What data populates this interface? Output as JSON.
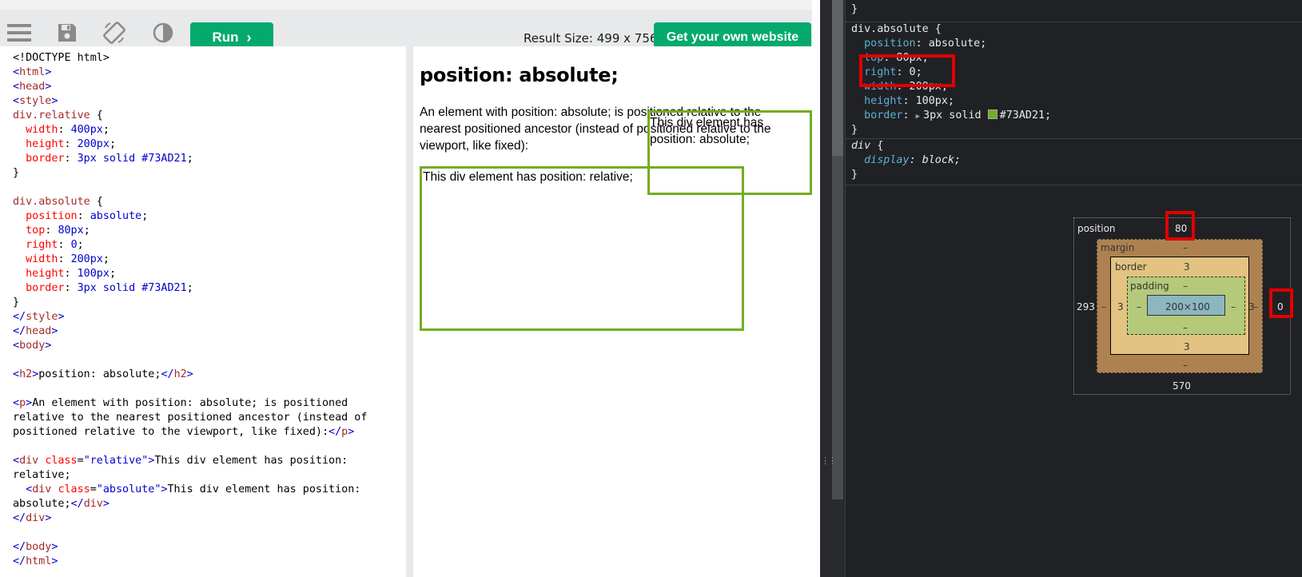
{
  "toolbar": {
    "icons": [
      "menu-icon",
      "save-icon",
      "rotate-icon",
      "contrast-icon"
    ],
    "run_label": "Run",
    "result_size": "Result Size: 499 x 756",
    "own_site_label": "Get your own website",
    "accent": "#04aa6d"
  },
  "editor": {
    "lines": [
      [
        [
          "p",
          "<!DOCTYPE html>"
        ]
      ],
      [
        [
          "a",
          "<"
        ],
        [
          "t",
          "html"
        ],
        [
          "a",
          ">"
        ]
      ],
      [
        [
          "a",
          "<"
        ],
        [
          "t",
          "head"
        ],
        [
          "a",
          ">"
        ]
      ],
      [
        [
          "a",
          "<"
        ],
        [
          "t",
          "style"
        ],
        [
          "a",
          ">"
        ]
      ],
      [
        [
          "s",
          "div.relative"
        ],
        [
          "p",
          " {"
        ]
      ],
      [
        [
          "p",
          "  "
        ],
        [
          "k",
          "width"
        ],
        [
          "p",
          ": "
        ],
        [
          "v",
          "400px"
        ],
        [
          "p",
          ";"
        ]
      ],
      [
        [
          "p",
          "  "
        ],
        [
          "k",
          "height"
        ],
        [
          "p",
          ": "
        ],
        [
          "v",
          "200px"
        ],
        [
          "p",
          ";"
        ]
      ],
      [
        [
          "p",
          "  "
        ],
        [
          "k",
          "border"
        ],
        [
          "p",
          ": "
        ],
        [
          "v",
          "3px solid #73AD21"
        ],
        [
          "p",
          ";"
        ]
      ],
      [
        [
          "p",
          "}"
        ]
      ],
      [
        [
          "p",
          ""
        ]
      ],
      [
        [
          "s",
          "div.absolute"
        ],
        [
          "p",
          " {"
        ]
      ],
      [
        [
          "p",
          "  "
        ],
        [
          "k",
          "position"
        ],
        [
          "p",
          ": "
        ],
        [
          "v",
          "absolute"
        ],
        [
          "p",
          ";"
        ]
      ],
      [
        [
          "p",
          "  "
        ],
        [
          "k",
          "top"
        ],
        [
          "p",
          ": "
        ],
        [
          "v",
          "80px"
        ],
        [
          "p",
          ";"
        ]
      ],
      [
        [
          "p",
          "  "
        ],
        [
          "k",
          "right"
        ],
        [
          "p",
          ": "
        ],
        [
          "v",
          "0"
        ],
        [
          "p",
          ";"
        ]
      ],
      [
        [
          "p",
          "  "
        ],
        [
          "k",
          "width"
        ],
        [
          "p",
          ": "
        ],
        [
          "v",
          "200px"
        ],
        [
          "p",
          ";"
        ]
      ],
      [
        [
          "p",
          "  "
        ],
        [
          "k",
          "height"
        ],
        [
          "p",
          ": "
        ],
        [
          "v",
          "100px"
        ],
        [
          "p",
          ";"
        ]
      ],
      [
        [
          "p",
          "  "
        ],
        [
          "k",
          "border"
        ],
        [
          "p",
          ": "
        ],
        [
          "v",
          "3px solid #73AD21"
        ],
        [
          "p",
          ";"
        ]
      ],
      [
        [
          "p",
          "}"
        ]
      ],
      [
        [
          "a",
          "</"
        ],
        [
          "t",
          "style"
        ],
        [
          "a",
          ">"
        ]
      ],
      [
        [
          "a",
          "</"
        ],
        [
          "t",
          "head"
        ],
        [
          "a",
          ">"
        ]
      ],
      [
        [
          "a",
          "<"
        ],
        [
          "t",
          "body"
        ],
        [
          "a",
          ">"
        ]
      ],
      [
        [
          "p",
          ""
        ]
      ],
      [
        [
          "a",
          "<"
        ],
        [
          "t",
          "h2"
        ],
        [
          "a",
          ">"
        ],
        [
          "p",
          "position: absolute;"
        ],
        [
          "a",
          "</"
        ],
        [
          "t",
          "h2"
        ],
        [
          "a",
          ">"
        ]
      ],
      [
        [
          "p",
          ""
        ]
      ],
      [
        [
          "a",
          "<"
        ],
        [
          "t",
          "p"
        ],
        [
          "a",
          ">"
        ],
        [
          "p",
          "An element with position: absolute; is positioned"
        ]
      ],
      [
        [
          "p",
          "relative to the nearest positioned ancestor (instead of"
        ]
      ],
      [
        [
          "p",
          "positioned relative to the viewport, like fixed):"
        ],
        [
          "a",
          "</"
        ],
        [
          "t",
          "p"
        ],
        [
          "a",
          ">"
        ]
      ],
      [
        [
          "p",
          ""
        ]
      ],
      [
        [
          "a",
          "<"
        ],
        [
          "t",
          "div"
        ],
        [
          "p",
          " "
        ],
        [
          "r",
          "class"
        ],
        [
          "p",
          "="
        ],
        [
          "q",
          "\"relative\""
        ],
        [
          "a",
          ">"
        ],
        [
          "p",
          "This div element has position:"
        ]
      ],
      [
        [
          "p",
          "relative;"
        ]
      ],
      [
        [
          "p",
          "  "
        ],
        [
          "a",
          "<"
        ],
        [
          "t",
          "div"
        ],
        [
          "p",
          " "
        ],
        [
          "r",
          "class"
        ],
        [
          "p",
          "="
        ],
        [
          "q",
          "\"absolute\""
        ],
        [
          "a",
          ">"
        ],
        [
          "p",
          "This div element has position:"
        ]
      ],
      [
        [
          "p",
          "absolute;"
        ],
        [
          "a",
          "</"
        ],
        [
          "t",
          "div"
        ],
        [
          "a",
          ">"
        ]
      ],
      [
        [
          "a",
          "</"
        ],
        [
          "t",
          "div"
        ],
        [
          "a",
          ">"
        ]
      ],
      [
        [
          "p",
          ""
        ]
      ],
      [
        [
          "a",
          "</"
        ],
        [
          "t",
          "body"
        ],
        [
          "a",
          ">"
        ]
      ],
      [
        [
          "a",
          "</"
        ],
        [
          "t",
          "html"
        ],
        [
          "a",
          ">"
        ]
      ]
    ]
  },
  "result": {
    "heading": "position: absolute;",
    "paragraph": "An element with position: absolute; is positioned relative to the nearest positioned ancestor (instead of positioned relative to the viewport, like fixed):",
    "relative_text": "This div element has position: relative;",
    "absolute_text": "This div element has position: absolute;",
    "border_color": "#73ad21"
  },
  "devtools": {
    "style_lines": [
      [
        [
          "v",
          "}"
        ]
      ],
      [
        [
          "v",
          "div.absolute {"
        ]
      ],
      [
        [
          "v",
          "  "
        ],
        [
          "k",
          "position"
        ],
        [
          "v",
          ": absolute;"
        ]
      ],
      [
        [
          "v",
          "  "
        ],
        [
          "k",
          "top"
        ],
        [
          "v",
          ": 80px;"
        ]
      ],
      [
        [
          "v",
          "  "
        ],
        [
          "k",
          "right"
        ],
        [
          "v",
          ": 0;"
        ]
      ],
      [
        [
          "v",
          "  "
        ],
        [
          "k",
          "width"
        ],
        [
          "v",
          ": 200px;"
        ]
      ],
      [
        [
          "v",
          "  "
        ],
        [
          "k",
          "height"
        ],
        [
          "v",
          ": 100px;"
        ]
      ],
      [
        [
          "v",
          "  "
        ],
        [
          "k",
          "border"
        ],
        [
          "v",
          ": "
        ],
        [
          "tri",
          "▶"
        ],
        [
          "sw",
          ""
        ],
        [
          "v",
          "3px solid "
        ],
        [
          "sw2",
          ""
        ],
        [
          "v",
          "#73AD21;"
        ]
      ],
      [
        [
          "v",
          "}"
        ]
      ],
      [
        [
          "si",
          "div"
        ],
        [
          "v",
          " {"
        ]
      ],
      [
        [
          "v",
          "  "
        ],
        [
          "ki",
          "display"
        ],
        [
          "vi",
          ": block;"
        ]
      ],
      [
        [
          "v",
          "}"
        ]
      ]
    ],
    "swatch_color": "#73ad21",
    "highlight_color": "#e00000",
    "box_model": {
      "position_label": "position",
      "position_top": "80",
      "position_left": "293",
      "position_right": "0",
      "position_bottom": "570",
      "margin_label": "margin",
      "margin_value": "–",
      "border_label": "border",
      "border_value": "3",
      "padding_label": "padding",
      "padding_value": "–",
      "content_size": "200×100"
    }
  }
}
